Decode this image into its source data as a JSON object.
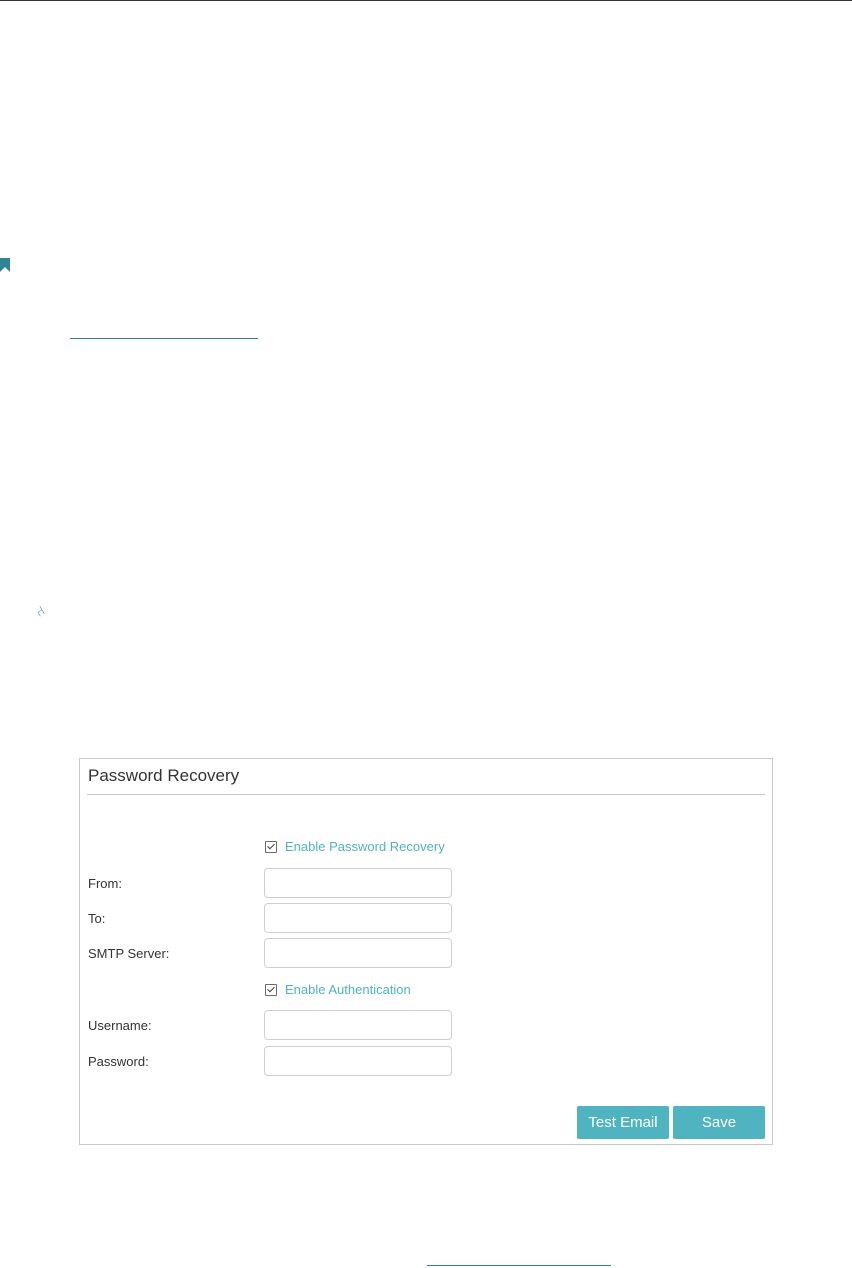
{
  "panel": {
    "title": "Password Recovery",
    "enable_password_recovery": {
      "label": "Enable Password Recovery",
      "checked": true
    },
    "fields": {
      "from": {
        "label": "From:",
        "value": ""
      },
      "to": {
        "label": "To:",
        "value": ""
      },
      "smtp_server": {
        "label": "SMTP Server:",
        "value": ""
      },
      "username": {
        "label": "Username:",
        "value": ""
      },
      "password": {
        "label": "Password:",
        "value": ""
      }
    },
    "enable_authentication": {
      "label": "Enable Authentication",
      "checked": true
    },
    "buttons": {
      "test_email": "Test Email",
      "save": "Save"
    }
  },
  "icons": {
    "bookmark": "bookmark-icon",
    "note": "paperclip-icon",
    "checkbox": "check-icon"
  },
  "colors": {
    "accent": "#4fb3c0",
    "link": "#2f8596",
    "border": "#c8c8c8"
  }
}
